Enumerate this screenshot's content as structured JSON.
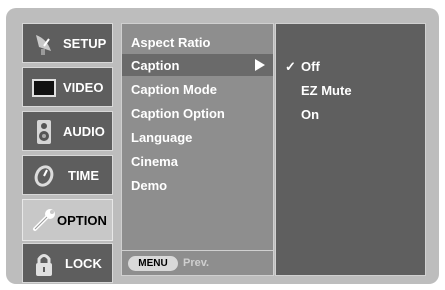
{
  "categories": [
    {
      "id": "setup",
      "label": "SETUP",
      "icon": "satellite-dish-icon",
      "active": false
    },
    {
      "id": "video",
      "label": "VIDEO",
      "icon": "tv-screen-icon",
      "active": false
    },
    {
      "id": "audio",
      "label": "AUDIO",
      "icon": "speaker-icon",
      "active": false
    },
    {
      "id": "time",
      "label": "TIME",
      "icon": "clock-icon",
      "active": false
    },
    {
      "id": "option",
      "label": "OPTION",
      "icon": "wrench-icon",
      "active": true
    },
    {
      "id": "lock",
      "label": "LOCK",
      "icon": "padlock-icon",
      "active": false
    }
  ],
  "menu": {
    "items": [
      {
        "label": "Aspect Ratio",
        "selected": false
      },
      {
        "label": "Caption",
        "selected": true
      },
      {
        "label": "Caption Mode",
        "selected": false
      },
      {
        "label": "Caption Option",
        "selected": false
      },
      {
        "label": "Language",
        "selected": false
      },
      {
        "label": "Cinema",
        "selected": false
      },
      {
        "label": "Demo",
        "selected": false
      }
    ],
    "footer": {
      "button_label": "MENU",
      "hint": "Prev."
    }
  },
  "options": {
    "items": [
      {
        "label": "Off",
        "checked": true
      },
      {
        "label": "EZ Mute",
        "checked": false
      },
      {
        "label": "On",
        "checked": false
      }
    ],
    "check_glyph": "✓"
  },
  "colors": {
    "frame": "#bdbdbd",
    "category_bg": "#5e5e5e",
    "category_active_bg": "#c8c8c8",
    "menu_bg": "#8e8e8e",
    "options_bg": "#5f5f5f"
  }
}
